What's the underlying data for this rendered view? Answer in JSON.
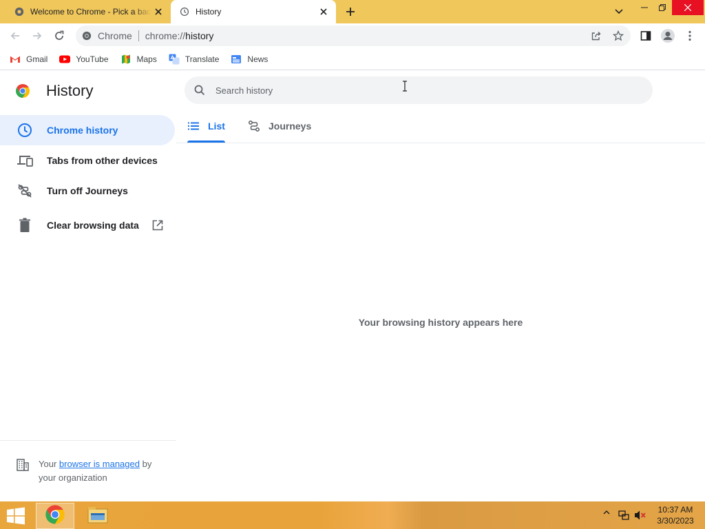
{
  "window": {
    "tabs": [
      {
        "title": "Welcome to Chrome - Pick a background",
        "close": "×"
      },
      {
        "title": "History",
        "close": "×"
      }
    ],
    "new_tab": "+"
  },
  "toolbar": {
    "site_chip": "Chrome",
    "url_scheme": "chrome://",
    "url_host": "history"
  },
  "bookmarks": [
    {
      "label": "Gmail",
      "icon": "gmail-icon"
    },
    {
      "label": "YouTube",
      "icon": "youtube-icon"
    },
    {
      "label": "Maps",
      "icon": "maps-icon"
    },
    {
      "label": "Translate",
      "icon": "translate-icon"
    },
    {
      "label": "News",
      "icon": "news-icon"
    }
  ],
  "page": {
    "title": "History",
    "search_placeholder": "Search history",
    "sidebar": [
      {
        "label": "Chrome history",
        "icon": "clock-icon",
        "selected": true
      },
      {
        "label": "Tabs from other devices",
        "icon": "devices-icon"
      },
      {
        "label": "Turn off Journeys",
        "icon": "journeys-off-icon"
      },
      {
        "label": "Clear browsing data",
        "icon": "trash-icon"
      }
    ],
    "footer": {
      "prefix": "Your",
      "link": "browser is managed",
      "suffix": "by your organization"
    },
    "tabs": [
      {
        "label": "List",
        "selected": true
      },
      {
        "label": "Journeys",
        "selected": false
      }
    ],
    "empty_message": "Your browsing history appears here"
  },
  "taskbar": {
    "time": "10:37 AM",
    "date": "3/30/2023"
  },
  "colors": {
    "accent": "#1a73e8",
    "tabstrip": "#f0c75b",
    "selected_bg": "#e8f0fe"
  }
}
